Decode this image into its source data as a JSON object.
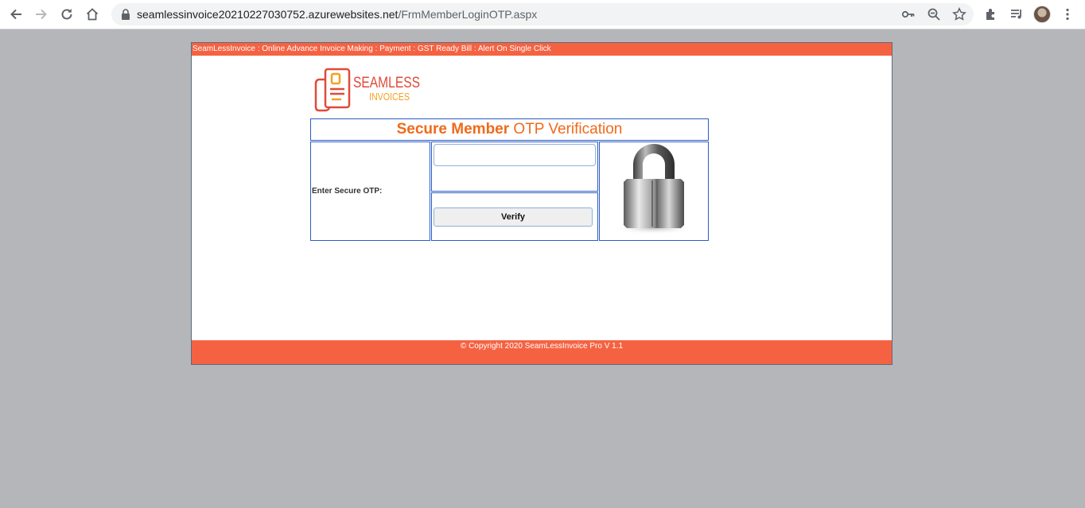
{
  "browser": {
    "url_host": "seamlessinvoice20210227030752.azurewebsites.net",
    "url_path": "/FrmMemberLoginOTP.aspx"
  },
  "page": {
    "banner": "SeamLessInvoice : Online Advance Invoice Making : Payment : GST Ready Bill : Alert On Single Click",
    "logo": {
      "line1": "SEAMLESS",
      "line2": "INVOICES"
    },
    "title_bold": "Secure Member",
    "title_rest": " OTP Verification",
    "otp_label": "Enter Secure OTP:",
    "otp_value": "",
    "verify_label": "Verify",
    "footer": "© Copyright 2020 SeamLessInvoice Pro V 1.1"
  },
  "colors": {
    "accent": "#f56242",
    "title": "#f06a1a",
    "table_border": "#2b5cc4",
    "background": "#b5b6ba"
  },
  "icons": [
    "back-icon",
    "forward-icon",
    "reload-icon",
    "home-icon",
    "lock-icon",
    "key-icon",
    "zoom-icon",
    "star-icon",
    "extensions-icon",
    "media-icon",
    "menu-icon",
    "padlock-icon"
  ]
}
